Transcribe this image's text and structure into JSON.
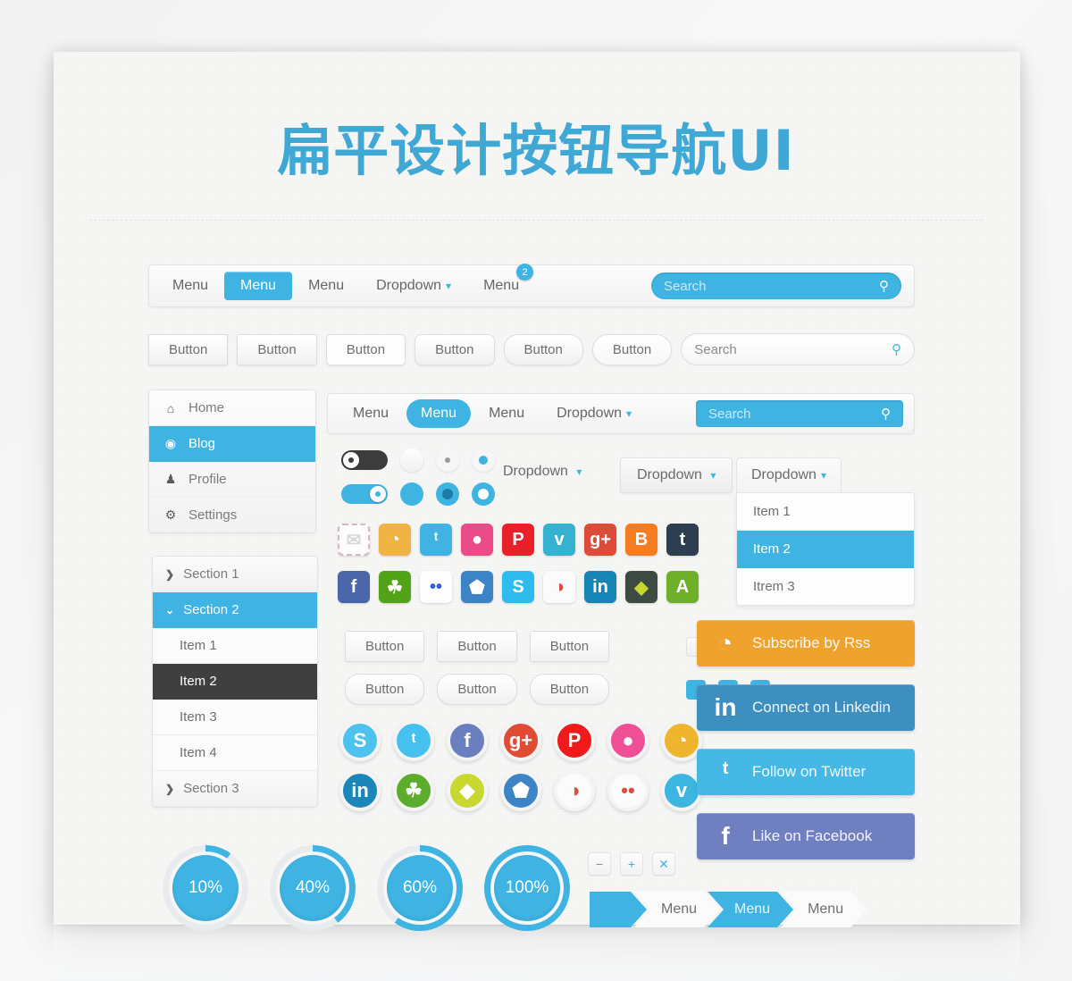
{
  "page": {
    "title": "扁平设计按钮导航UI",
    "accent_color": "#3fb3e2",
    "dark_color": "#3f3f3f"
  },
  "nav_top": {
    "items": [
      {
        "label": "Menu",
        "state": "normal"
      },
      {
        "label": "Menu",
        "state": "active"
      },
      {
        "label": "Menu",
        "state": "normal"
      },
      {
        "label": "Dropdown",
        "state": "dropdown",
        "caret": "chevron-down"
      },
      {
        "label": "Menu",
        "state": "badge",
        "badge": "2"
      }
    ],
    "search": {
      "placeholder": "Search",
      "icon": "search-icon"
    }
  },
  "button_row": {
    "buttons": [
      "Button",
      "Button",
      "Button",
      "Button",
      "Button",
      "Button"
    ],
    "search": {
      "placeholder": "Search",
      "icon": "search-icon"
    }
  },
  "sidebar_primary": {
    "items": [
      {
        "label": "Home",
        "icon": "home-icon",
        "glyph": "⌂",
        "active": false
      },
      {
        "label": "Blog",
        "icon": "target-icon",
        "glyph": "◉",
        "active": true
      },
      {
        "label": "Profile",
        "icon": "user-icon",
        "glyph": "♟",
        "active": false
      },
      {
        "label": "Settings",
        "icon": "gear-icon",
        "glyph": "⚙",
        "active": false
      }
    ]
  },
  "sidebar_accordion": {
    "rows": [
      {
        "label": "Section 1",
        "type": "section",
        "open": false,
        "arrow": "❯"
      },
      {
        "label": "Section 2",
        "type": "section",
        "open": true,
        "arrow": "⌄"
      },
      {
        "label": "Item 1",
        "type": "item",
        "selected": false
      },
      {
        "label": "Item 2",
        "type": "item",
        "selected": true
      },
      {
        "label": "Item 3",
        "type": "item",
        "selected": false
      },
      {
        "label": "Item 4",
        "type": "item",
        "selected": false
      },
      {
        "label": "Section 3",
        "type": "section",
        "open": false,
        "arrow": "❯"
      }
    ]
  },
  "nav_second": {
    "items": [
      {
        "label": "Menu",
        "state": "normal"
      },
      {
        "label": "Menu",
        "state": "active"
      },
      {
        "label": "Menu",
        "state": "normal"
      },
      {
        "label": "Dropdown",
        "state": "dropdown"
      }
    ],
    "search": {
      "placeholder": "Search",
      "icon": "search-icon"
    }
  },
  "dropdowns": {
    "plain_label": "Dropdown",
    "button_label": "Dropdown",
    "open": {
      "header": "Dropdown",
      "items": [
        {
          "label": "Item 1",
          "selected": false
        },
        {
          "label": "Item 2",
          "selected": true
        },
        {
          "label": "Itrem 3",
          "selected": false
        }
      ]
    }
  },
  "social_squares_row1": [
    {
      "name": "email-icon",
      "glyph": "✉",
      "bg": "#fdfdfd",
      "fg": "#d9d9d9",
      "dashed": true
    },
    {
      "name": "rss-icon",
      "glyph": "◔",
      "bg": "#efb443",
      "fg": "#ffffff"
    },
    {
      "name": "twitter-icon",
      "glyph": "ᵗ",
      "bg": "#3fb3e2",
      "fg": "#ffffff"
    },
    {
      "name": "dribbble-icon",
      "glyph": "●",
      "bg": "#ea4c89",
      "fg": "#ffffff"
    },
    {
      "name": "pinterest-icon",
      "glyph": "P",
      "bg": "#e8202a",
      "fg": "#ffffff"
    },
    {
      "name": "vimeo-icon",
      "glyph": "v",
      "bg": "#35b2d0",
      "fg": "#ffffff"
    },
    {
      "name": "googleplus-icon",
      "glyph": "g+",
      "bg": "#dd4b39",
      "fg": "#ffffff"
    },
    {
      "name": "blogger-icon",
      "glyph": "B",
      "bg": "#f57d20",
      "fg": "#ffffff"
    },
    {
      "name": "tumblr-icon",
      "glyph": "t",
      "bg": "#2c3e50",
      "fg": "#ffffff"
    }
  ],
  "social_squares_row2": [
    {
      "name": "facebook-icon",
      "glyph": "f",
      "bg": "#4a66a8",
      "fg": "#ffffff"
    },
    {
      "name": "evernote-icon",
      "glyph": "☘",
      "bg": "#53a318",
      "fg": "#ffffff"
    },
    {
      "name": "flickr-icon",
      "glyph": "••",
      "bg": "#fdfdfd",
      "fg": "#2c5fd6"
    },
    {
      "name": "dropbox-icon",
      "glyph": "⬟",
      "bg": "#3d84c6",
      "fg": "#ffffff"
    },
    {
      "name": "skype-icon",
      "glyph": "S",
      "bg": "#2ebbf0",
      "fg": "#ffffff"
    },
    {
      "name": "picasa-icon",
      "glyph": "◑",
      "bg": "#fbfbfb",
      "fg": "#d94f3d"
    },
    {
      "name": "linkedin-icon",
      "glyph": "in",
      "bg": "#1784b6",
      "fg": "#ffffff"
    },
    {
      "name": "deviantart-icon",
      "glyph": "◆",
      "bg": "#3c4a42",
      "fg": "#c7d62e"
    },
    {
      "name": "forrst-icon",
      "glyph": "A",
      "bg": "#6eb02a",
      "fg": "#ffffff"
    }
  ],
  "social_circles_row1": [
    {
      "name": "skype-icon",
      "glyph": "S",
      "bg": "#4ec2ef"
    },
    {
      "name": "twitter-icon",
      "glyph": "ᵗ",
      "bg": "#45c0ef"
    },
    {
      "name": "facebook-icon",
      "glyph": "f",
      "bg": "#6b7fc0"
    },
    {
      "name": "googleplus-icon",
      "glyph": "g+",
      "bg": "#e04b33"
    },
    {
      "name": "pinterest-icon",
      "glyph": "P",
      "bg": "#f01a1a"
    },
    {
      "name": "dribbble-icon",
      "glyph": "●",
      "bg": "#ef4f96"
    },
    {
      "name": "rss-icon",
      "glyph": "◔",
      "bg": "#f0b52e"
    }
  ],
  "social_circles_row2": [
    {
      "name": "linkedin-icon",
      "glyph": "in",
      "bg": "#1b87b9"
    },
    {
      "name": "evernote-icon",
      "glyph": "☘",
      "bg": "#5cad2b"
    },
    {
      "name": "deviantart-icon",
      "glyph": "◆",
      "bg": "#c9d830"
    },
    {
      "name": "dropbox-icon",
      "glyph": "⬟",
      "bg": "#3d84c6"
    },
    {
      "name": "picasa-icon",
      "glyph": "◑",
      "bg": "#fbfbfb"
    },
    {
      "name": "flickr-icon",
      "glyph": "••",
      "bg": "#fbfbfb"
    },
    {
      "name": "vimeo-icon",
      "glyph": "v",
      "bg": "#3ab6e0"
    }
  ],
  "mid_buttons": {
    "row1": [
      "Button",
      "Button",
      "Button"
    ],
    "row2": [
      "Button",
      "Button",
      "Button"
    ]
  },
  "checkboxes": {
    "row1": [
      {
        "state": "empty",
        "glyph": ""
      },
      {
        "state": "cross",
        "glyph": "✘"
      },
      {
        "state": "check",
        "glyph": "✔"
      }
    ],
    "row2": [
      {
        "state": "filled",
        "glyph": ""
      },
      {
        "state": "cross",
        "glyph": "✘"
      },
      {
        "state": "check",
        "glyph": "✔"
      }
    ]
  },
  "cta_buttons": [
    {
      "label": "Subscribe by Rss",
      "icon": "rss-icon",
      "glyph": "◔",
      "bg": "#efa22e"
    },
    {
      "label": "Connect on Linkedin",
      "icon": "linkedin-icon",
      "glyph": "in",
      "bg": "#3d8fc0"
    },
    {
      "label": "Follow on Twitter",
      "icon": "twitter-icon",
      "glyph": "ᵗ",
      "bg": "#45b8e5"
    },
    {
      "label": "Like on Facebook",
      "icon": "facebook-icon",
      "glyph": "f",
      "bg": "#6f7fc0"
    }
  ],
  "progress_circles": [
    {
      "label": "10%",
      "value": 10
    },
    {
      "label": "40%",
      "value": 40
    },
    {
      "label": "60%",
      "value": 60
    },
    {
      "label": "100%",
      "value": 100
    }
  ],
  "tiny_buttons": [
    {
      "name": "minus-button",
      "glyph": "−"
    },
    {
      "name": "plus-button",
      "glyph": "+"
    },
    {
      "name": "close-button",
      "glyph": "✕"
    }
  ],
  "breadcrumbs": [
    {
      "label": "",
      "style": "blue",
      "first": true
    },
    {
      "label": "Menu",
      "style": "plain"
    },
    {
      "label": "Menu",
      "style": "blue"
    },
    {
      "label": "Menu",
      "style": "plain"
    }
  ],
  "toggles": [
    {
      "state": "off",
      "name": "toggle-off"
    },
    {
      "state": "on",
      "name": "toggle-on"
    }
  ],
  "radios_row1": [
    "empty",
    "dotgrey",
    "dotblue"
  ],
  "radios_row2": [
    "solid",
    "ring-dark",
    "ring-white"
  ]
}
